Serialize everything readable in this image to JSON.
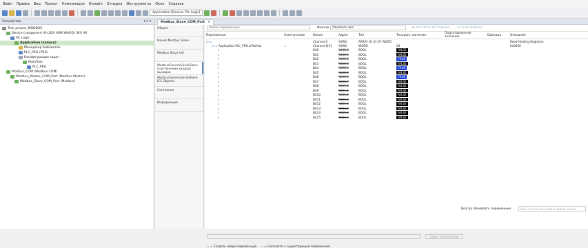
{
  "menu": [
    "Файл",
    "Правка",
    "Вид",
    "Проект",
    "Компиляция",
    "Онлайн",
    "Отладка",
    "Инструменты",
    "Окно",
    "Справка"
  ],
  "toolbar": {
    "device_combo": "Application [Device: Plc Logic]"
  },
  "devices_pane": {
    "title": "Устройства",
    "pin": "▾ ‡ ✕"
  },
  "tree": [
    {
      "text": "Test_project_MODBUS",
      "indent": 0,
      "color": "#888"
    },
    {
      "text": "Device (соединен) (R-LIDA ARM WAGO) (Nl) AR",
      "indent": 1,
      "color": "#6fae5c",
      "sel": true
    },
    {
      "text": "Plc Logic",
      "indent": 2,
      "color": "#5b86c6"
    },
    {
      "text": "Application (запуск)",
      "indent": 3,
      "color": "#6fae5c",
      "bold": true,
      "sel": true
    },
    {
      "text": "Менеджер библиотек",
      "indent": 4,
      "color": "#d9b44a"
    },
    {
      "text": "PLC_PRG (PRG)",
      "indent": 4,
      "color": "#5b86c6"
    },
    {
      "text": "Конфигурация задач",
      "indent": 4,
      "color": "#9aa7b8"
    },
    {
      "text": "MainTask",
      "indent": 5,
      "color": "#6fae5c"
    },
    {
      "text": "PLC_PRG",
      "indent": 6,
      "color": "#5b86c6"
    },
    {
      "text": "Modbus_COM (Modbus COM)",
      "indent": 1,
      "color": "#6fae5c"
    },
    {
      "text": "Modbus_Master_COM_Port (Modbus Master)",
      "indent": 2,
      "color": "#6fae5c"
    },
    {
      "text": "Modbus_Slave_COM_Port (Modbus)",
      "indent": 3,
      "color": "#6fae5c"
    }
  ],
  "doc_tab": {
    "title": "Modbus_Slave_COM_Port",
    "close": "✕"
  },
  "side_tabs": [
    "Общее",
    "Канал Modbus Slave",
    "Modbus Slave Init",
    "ModbusGenericSerialSlave Соотнесение входов/выходов",
    "ModbusGenericSerialSlave IEC Objects",
    "Состояние",
    "Информация"
  ],
  "filter": {
    "placeholder": "Найти переменную",
    "label": "Фильтр",
    "select": "Показать все",
    "action1": "✚ Add FB for IO Channel...",
    "action2": "↷ Go to Instance"
  },
  "columns": [
    "Переменная",
    "Соотнесение",
    "Канал",
    "Адрес",
    "Тип",
    "Текущее значение",
    "Подготовленное значение",
    "Единица",
    "Описание"
  ],
  "rows": [
    {
      "var": "",
      "ch": "Channel 0",
      "addr": "%IW0",
      "type": "ARRAY [0..0] OF WORD",
      "cur": "",
      "desc": "Read Holding Registers",
      "strike": false,
      "lvl": 0
    },
    {
      "var": "Application.PLC_PRG.wTestVar",
      "ch": "Channel 0[0]",
      "addr": "%IW0",
      "type": "WORD",
      "cur": "",
      "val": "64",
      "desc": "0x0000",
      "strike": false,
      "lvl": 1,
      "map": true
    },
    {
      "var": "",
      "ch": "Bit0",
      "addr": "%IX0.0",
      "type": "BOOL",
      "cur": "FALSE",
      "strike": true,
      "lvl": 2
    },
    {
      "var": "",
      "ch": "Bit1",
      "addr": "%IX0.1",
      "type": "BOOL",
      "cur": "FALSE",
      "strike": true,
      "lvl": 2
    },
    {
      "var": "",
      "ch": "Bit2",
      "addr": "%IX0.2",
      "type": "BOOL",
      "cur": "TRUE",
      "strike": true,
      "lvl": 2
    },
    {
      "var": "",
      "ch": "Bit3",
      "addr": "%IX0.3",
      "type": "BOOL",
      "cur": "FALSE",
      "strike": true,
      "lvl": 2
    },
    {
      "var": "",
      "ch": "Bit4",
      "addr": "%IX0.4",
      "type": "BOOL",
      "cur": "TRUE",
      "strike": true,
      "lvl": 2
    },
    {
      "var": "",
      "ch": "Bit5",
      "addr": "%IX0.5",
      "type": "BOOL",
      "cur": "FALSE",
      "strike": true,
      "lvl": 2
    },
    {
      "var": "",
      "ch": "Bit6",
      "addr": "%IX0.6",
      "type": "BOOL",
      "cur": "TRUE",
      "strike": true,
      "lvl": 2
    },
    {
      "var": "",
      "ch": "Bit7",
      "addr": "%IX0.7",
      "type": "BOOL",
      "cur": "FALSE",
      "strike": true,
      "lvl": 2
    },
    {
      "var": "",
      "ch": "Bit8",
      "addr": "%IX1.0",
      "type": "BOOL",
      "cur": "FALSE",
      "strike": true,
      "lvl": 2
    },
    {
      "var": "",
      "ch": "Bit9",
      "addr": "%IX1.1",
      "type": "BOOL",
      "cur": "FALSE",
      "strike": true,
      "lvl": 2
    },
    {
      "var": "",
      "ch": "Bit10",
      "addr": "%IX1.2",
      "type": "BOOL",
      "cur": "FALSE",
      "strike": true,
      "lvl": 2
    },
    {
      "var": "",
      "ch": "Bit11",
      "addr": "%IX1.3",
      "type": "BOOL",
      "cur": "FALSE",
      "strike": true,
      "lvl": 2
    },
    {
      "var": "",
      "ch": "Bit12",
      "addr": "%IX1.4",
      "type": "BOOL",
      "cur": "FALSE",
      "strike": true,
      "lvl": 2
    },
    {
      "var": "",
      "ch": "Bit13",
      "addr": "%IX1.5",
      "type": "BOOL",
      "cur": "FALSE",
      "strike": true,
      "lvl": 2
    },
    {
      "var": "",
      "ch": "Bit14",
      "addr": "%IX1.6",
      "type": "BOOL",
      "cur": "FALSE",
      "strike": true,
      "lvl": 2
    },
    {
      "var": "",
      "ch": "Bit15",
      "addr": "%IX1.7",
      "type": "BOOL",
      "cur": "FALSE",
      "strike": true,
      "lvl": 2
    }
  ],
  "bottom": {
    "update_label": "Всегда обновлять переменные",
    "update_select": "Вкл. 2 (если не в задаче цикла шины)",
    "reset_button": "Сброс соотнесения",
    "legend_new": "= Создать новую переменную",
    "legend_map": "= Соотнести с существующей переменной"
  }
}
